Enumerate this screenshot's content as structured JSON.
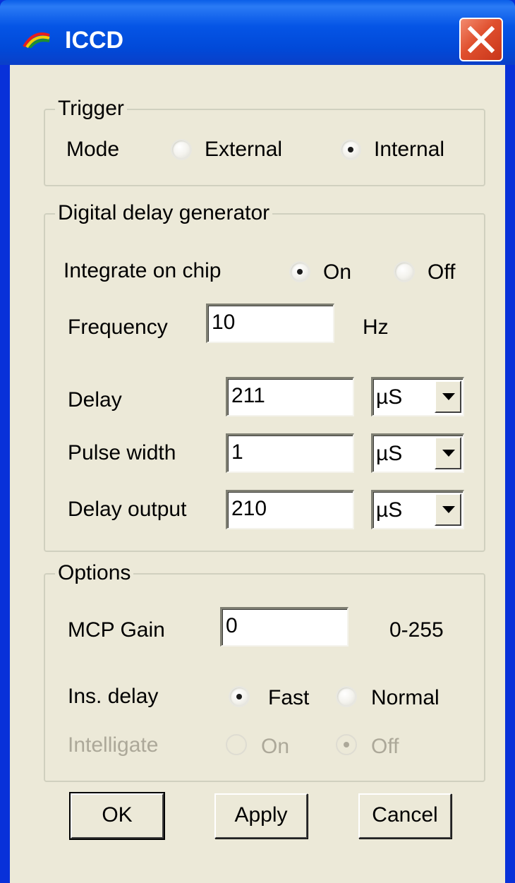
{
  "window": {
    "title": "ICCD",
    "app_icon": "rainbow-icon",
    "close_icon": "close-icon"
  },
  "trigger": {
    "legend": "Trigger",
    "mode_label": "Mode",
    "options": [
      {
        "label": "External",
        "checked": false
      },
      {
        "label": "Internal",
        "checked": true
      }
    ]
  },
  "ddg": {
    "legend": "Digital delay generator",
    "integrate_label": "Integrate on chip",
    "integrate_on": "On",
    "integrate_off": "Off",
    "integrate_selected": "On",
    "frequency_label": "Frequency",
    "frequency_value": "10",
    "frequency_unit": "Hz",
    "delay_label": "Delay",
    "delay_value": "211",
    "delay_unit": "µS",
    "pulse_label": "Pulse width",
    "pulse_value": "1",
    "pulse_unit": "µS",
    "delay_output_label": "Delay output",
    "delay_output_value": "210",
    "delay_output_unit": "µS"
  },
  "options": {
    "legend": "Options",
    "mcp_label": "MCP Gain",
    "mcp_value": "0",
    "mcp_range": "0-255",
    "ins_delay_label": "Ins. delay",
    "ins_fast": "Fast",
    "ins_normal": "Normal",
    "ins_selected": "Fast",
    "intelligate_label": "Intelligate",
    "intelligate_on": "On",
    "intelligate_off": "Off",
    "intelligate_selected": "Off",
    "intelligate_enabled": false
  },
  "buttons": {
    "ok": "OK",
    "apply": "Apply",
    "cancel": "Cancel"
  },
  "colors": {
    "titlebar": "#0555e6",
    "close": "#e0502e",
    "face": "#ece9d8",
    "disabled_text": "#aca899"
  }
}
